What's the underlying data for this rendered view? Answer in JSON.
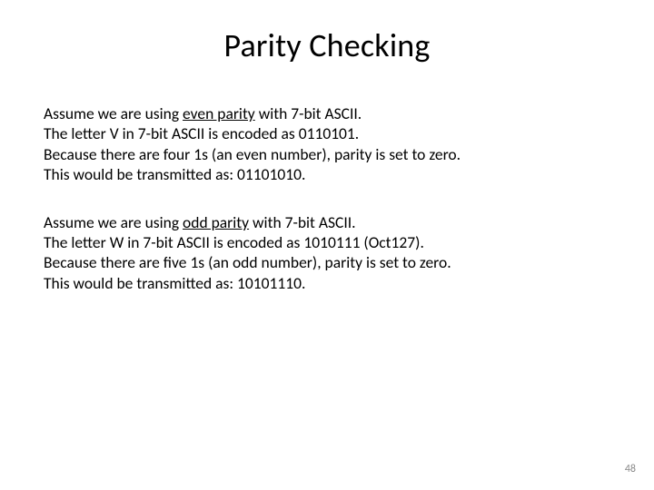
{
  "title": "Parity Checking",
  "p1": {
    "l1a": "Assume we are using ",
    "l1u": "even parity",
    "l1b": " with 7-bit ASCII.",
    "l2": "The letter V in 7-bit ASCII is encoded as 0110101.",
    "l3": "Because there are four 1s (an even number), parity is set to zero.",
    "l4": "This would be transmitted as: 01101010."
  },
  "p2": {
    "l1a": "Assume we are using ",
    "l1u": "odd parity",
    "l1b": " with 7-bit ASCII.",
    "l2": "The letter W in 7-bit ASCII is encoded as 1010111 (Oct127).",
    "l3": "Because there are five 1s (an odd number), parity is set to zero.",
    "l4": "This would be transmitted as: 10101110."
  },
  "page_number": "48"
}
